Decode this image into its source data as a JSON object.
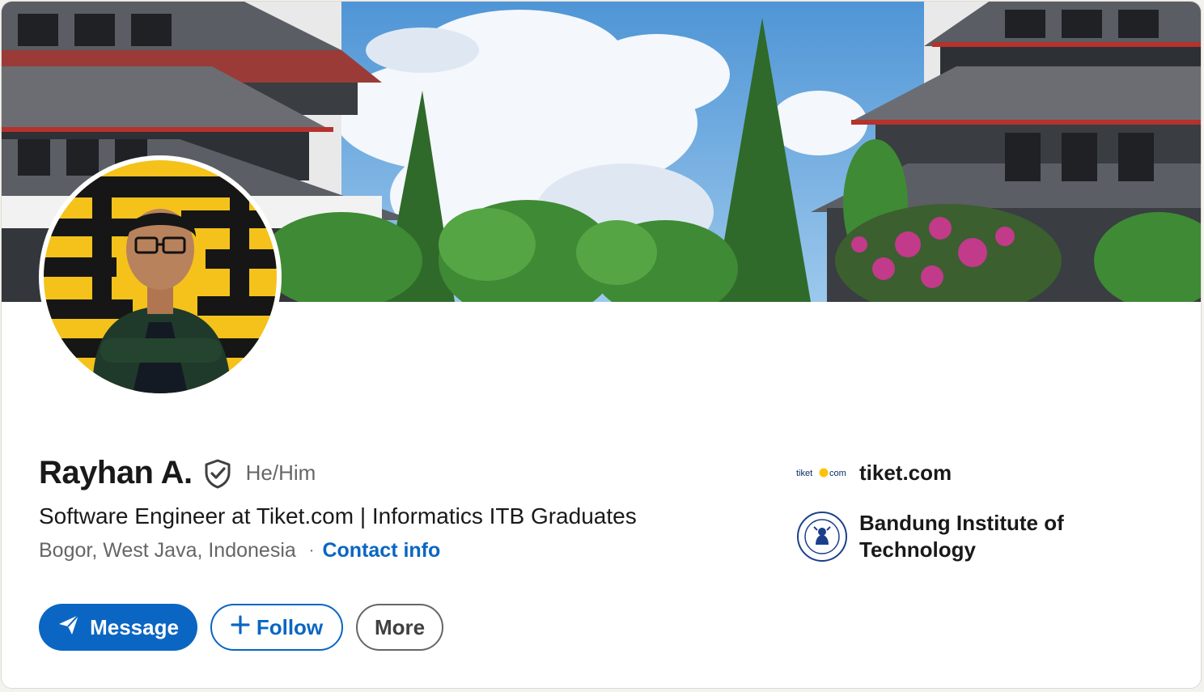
{
  "profile": {
    "name": "Rayhan A.",
    "pronouns": "He/Him",
    "headline": "Software Engineer at Tiket.com | Informatics ITB Graduates",
    "location": "Bogor, West Java, Indonesia",
    "separator": "·",
    "contact_label": "Contact info"
  },
  "actions": {
    "message_label": "Message",
    "follow_label": "Follow",
    "more_label": "More"
  },
  "experience": {
    "company_label": "tiket.com",
    "company_logo_text": "tiket",
    "company_logo_suffix": "com",
    "school_label_line1": "Bandung Institute of",
    "school_label_line2": "Technology"
  },
  "icons": {
    "verified": "shield-check-icon",
    "message": "paper-plane-icon",
    "follow": "plus-icon"
  },
  "colors": {
    "brand_blue": "#0a66c2",
    "text_primary": "#191919",
    "text_secondary": "#666666",
    "tiket_yellow": "#ffc107"
  }
}
